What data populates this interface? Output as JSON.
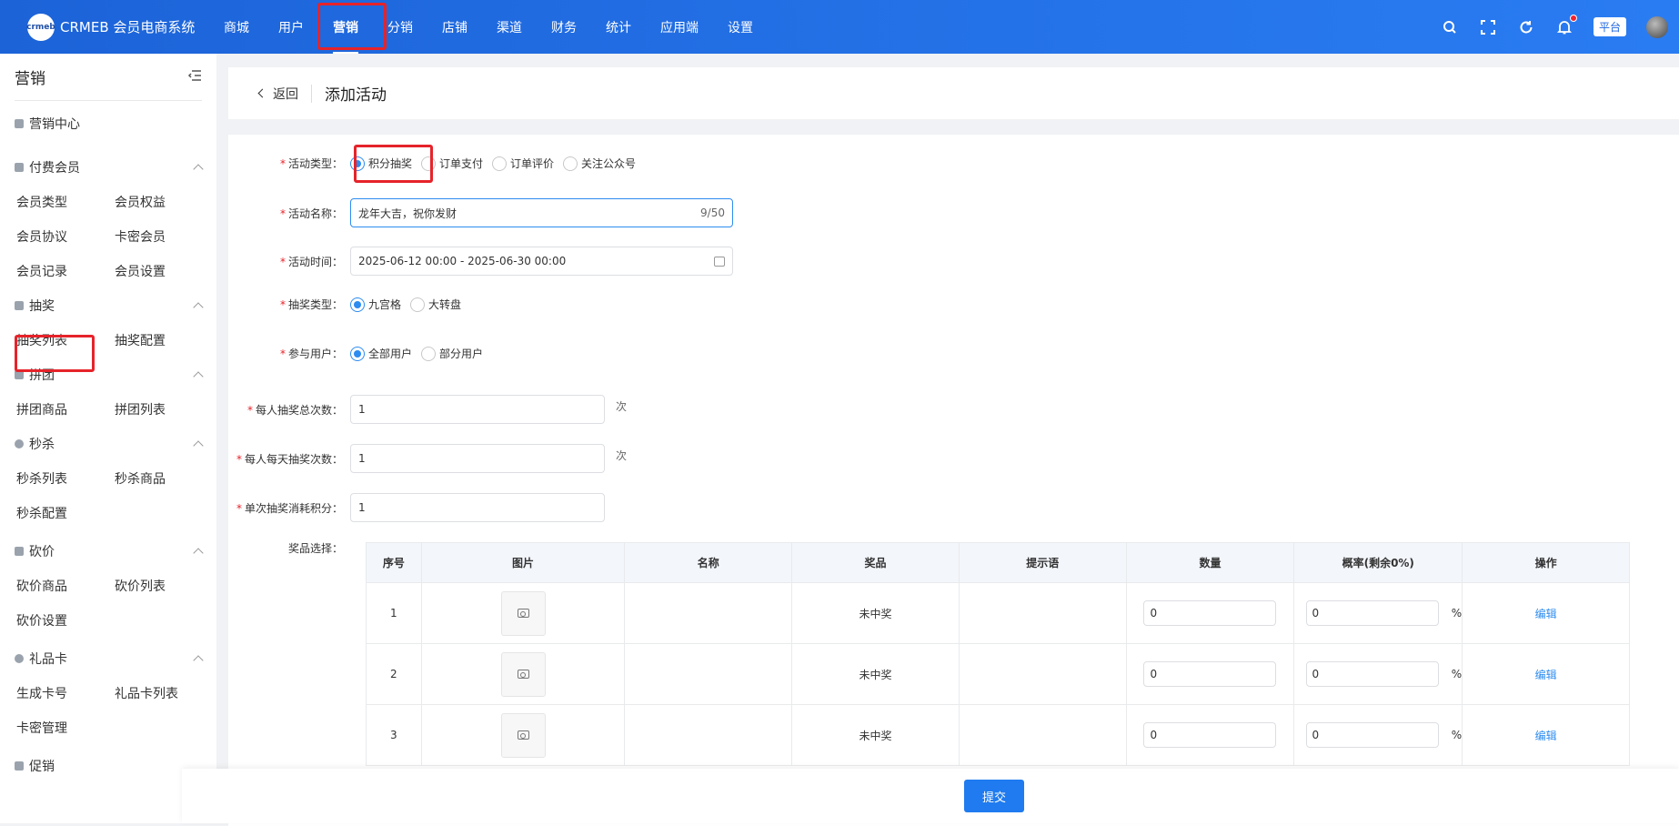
{
  "app": {
    "logo_mark": "crmeb",
    "title": "CRMEB 会员电商系统",
    "nav": [
      "商城",
      "用户",
      "营销",
      "分销",
      "店铺",
      "渠道",
      "财务",
      "统计",
      "应用端",
      "设置"
    ],
    "platform": "平台"
  },
  "sidebar": {
    "title": "营销",
    "center": "营销中心",
    "groups": [
      {
        "title": "付费会员",
        "items": [
          "会员类型",
          "会员权益",
          "会员协议",
          "卡密会员",
          "会员记录",
          "会员设置"
        ]
      },
      {
        "title": "抽奖",
        "items": [
          "抽奖列表",
          "抽奖配置"
        ]
      },
      {
        "title": "拼团",
        "items": [
          "拼团商品",
          "拼团列表"
        ]
      },
      {
        "title": "秒杀",
        "items": [
          "秒杀列表",
          "秒杀商品",
          "秒杀配置"
        ]
      },
      {
        "title": "砍价",
        "items": [
          "砍价商品",
          "砍价列表",
          "砍价设置"
        ]
      },
      {
        "title": "礼品卡",
        "items": [
          "生成卡号",
          "礼品卡列表",
          "卡密管理"
        ]
      },
      {
        "title": "促销",
        "items": []
      }
    ]
  },
  "page": {
    "back": "返回",
    "title": "添加活动"
  },
  "form": {
    "activity_type": {
      "label": "活动类型：",
      "options": [
        "积分抽奖",
        "订单支付",
        "订单评价",
        "关注公众号"
      ]
    },
    "activity_name": {
      "label": "活动名称：",
      "value": "龙年大吉，祝你发财",
      "counter": "9/50"
    },
    "activity_time": {
      "label": "活动时间：",
      "value": "2025-06-12 00:00 - 2025-06-30 00:00"
    },
    "lottery_type": {
      "label": "抽奖类型：",
      "options": [
        "九宫格",
        "大转盘"
      ]
    },
    "participants": {
      "label": "参与用户：",
      "options": [
        "全部用户",
        "部分用户"
      ]
    },
    "total_times": {
      "label": "每人抽奖总次数：",
      "value": "1",
      "unit": "次"
    },
    "daily_times": {
      "label": "每人每天抽奖次数：",
      "value": "1",
      "unit": "次"
    },
    "points_cost": {
      "label": "单次抽奖消耗积分：",
      "value": "1"
    },
    "prize_label": "奖品选择："
  },
  "table": {
    "headers": [
      "序号",
      "图片",
      "名称",
      "奖品",
      "提示语",
      "数量",
      "概率(剩余0%)",
      "操作"
    ],
    "rows": [
      {
        "no": "1",
        "prize": "未中奖",
        "qty": "0",
        "prob": "0",
        "pct": "%",
        "action": "编辑"
      },
      {
        "no": "2",
        "prize": "未中奖",
        "qty": "0",
        "prob": "0",
        "pct": "%",
        "action": "编辑"
      },
      {
        "no": "3",
        "prize": "未中奖",
        "qty": "0",
        "prob": "0",
        "pct": "%",
        "action": "编辑"
      }
    ]
  },
  "footer": {
    "submit": "提交"
  }
}
